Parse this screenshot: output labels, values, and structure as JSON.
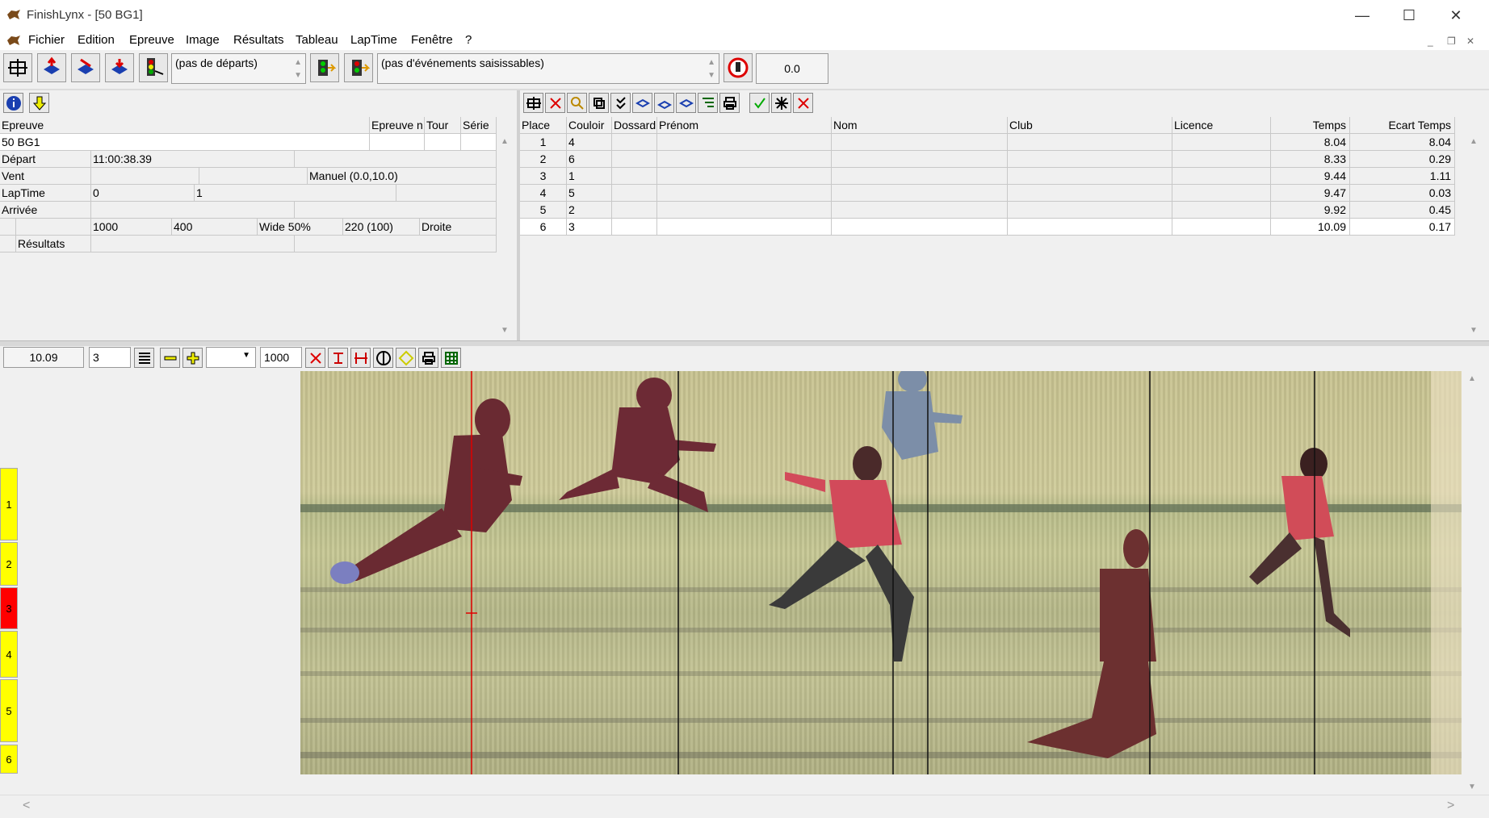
{
  "window": {
    "title": "FinishLynx - [50 BG1]",
    "minimize": "—",
    "maximize": "☐",
    "close": "✕"
  },
  "menu": [
    "Fichier",
    "Edition",
    "Epreuve",
    "Image",
    "Résultats",
    "Tableau",
    "LapTime",
    "Fenêtre",
    "?"
  ],
  "toolbar": {
    "starts_combo": "(pas de départs)",
    "events_combo": "(pas d'événements saisissables)",
    "wind_value": "0.0"
  },
  "event_grid": {
    "headers": [
      "Epreuve",
      "Epreuve n",
      "Tour",
      "Série"
    ],
    "event_name": "50 BG1",
    "rows": [
      {
        "label": "Départ",
        "values": [
          "11:00:38.39"
        ]
      },
      {
        "label": "Vent",
        "values": [
          "Manuel (0.0,10.0)"
        ]
      },
      {
        "label": "LapTime",
        "values": [
          "0",
          "1"
        ]
      },
      {
        "label": "Arrivée",
        "values": []
      },
      {
        "label": "",
        "values": [
          "1000",
          "400",
          "Wide 50%",
          "220  (100)",
          "Droite"
        ]
      },
      {
        "label": "Résultats",
        "values": []
      }
    ]
  },
  "results": {
    "headers": [
      "Place",
      "Couloir",
      "Dossard",
      "Prénom",
      "Nom",
      "Club",
      "Licence",
      "Temps",
      "Ecart Temps"
    ],
    "rows": [
      {
        "place": "1",
        "lane": "4",
        "time": "8.04",
        "gap": "8.04"
      },
      {
        "place": "2",
        "lane": "6",
        "time": "8.33",
        "gap": "0.29"
      },
      {
        "place": "3",
        "lane": "1",
        "time": "9.44",
        "gap": "1.11"
      },
      {
        "place": "4",
        "lane": "5",
        "time": "9.47",
        "gap": "0.03"
      },
      {
        "place": "5",
        "lane": "2",
        "time": "9.92",
        "gap": "0.45"
      },
      {
        "place": "6",
        "lane": "3",
        "time": "10.09",
        "gap": "0.17"
      }
    ]
  },
  "image_toolbar": {
    "time_field": "10.09",
    "lane_field": "3",
    "zoom_field": "1000"
  },
  "lanes": [
    {
      "label": "1",
      "color": "#ffff00"
    },
    {
      "label": "2",
      "color": "#ffff00"
    },
    {
      "label": "3",
      "color": "#ff0000"
    },
    {
      "label": "4",
      "color": "#ffff00"
    },
    {
      "label": "5",
      "color": "#ffff00"
    },
    {
      "label": "6",
      "color": "#ffff00"
    }
  ],
  "scroll": {
    "left": "<",
    "right": ">"
  }
}
